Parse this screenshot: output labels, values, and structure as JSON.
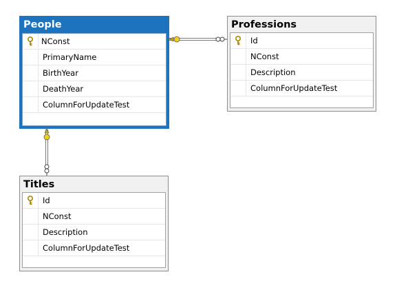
{
  "diagram": {
    "tables": [
      {
        "id": "people",
        "title": "People",
        "selected": true,
        "columns": [
          {
            "name": "NConst",
            "primary_key": true
          },
          {
            "name": "PrimaryName",
            "primary_key": false
          },
          {
            "name": "BirthYear",
            "primary_key": false
          },
          {
            "name": "DeathYear",
            "primary_key": false
          },
          {
            "name": "ColumnForUpdateTest",
            "primary_key": false
          }
        ]
      },
      {
        "id": "professions",
        "title": "Professions",
        "selected": false,
        "columns": [
          {
            "name": "Id",
            "primary_key": true
          },
          {
            "name": "NConst",
            "primary_key": false
          },
          {
            "name": "Description",
            "primary_key": false
          },
          {
            "name": "ColumnForUpdateTest",
            "primary_key": false
          }
        ]
      },
      {
        "id": "titles",
        "title": "Titles",
        "selected": false,
        "columns": [
          {
            "name": "Id",
            "primary_key": true
          },
          {
            "name": "NConst",
            "primary_key": false
          },
          {
            "name": "Description",
            "primary_key": false
          },
          {
            "name": "ColumnForUpdateTest",
            "primary_key": false
          }
        ]
      }
    ],
    "relationships": [
      {
        "from": "people",
        "to": "professions",
        "one_end": "people",
        "many_end": "professions"
      },
      {
        "from": "people",
        "to": "titles",
        "one_end": "people",
        "many_end": "titles"
      }
    ],
    "icons": {
      "primary_key": "key-icon"
    },
    "colors": {
      "selected_border": "#1e73be",
      "key_icon": "#d4a600",
      "connector": "#7a7a7a"
    }
  }
}
